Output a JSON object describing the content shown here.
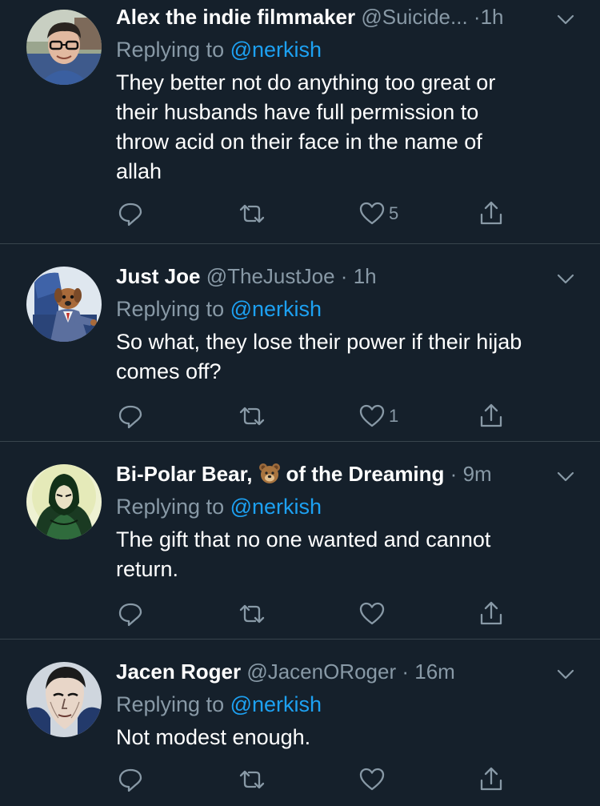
{
  "tweets": [
    {
      "display_name": "Alex the indie filmmaker",
      "handle": "@Suicide...",
      "separator": "·",
      "time": "1h",
      "replying_prefix": "Replying to",
      "replying_mention": "@nerkish",
      "text": "They better not do anything too great or\ntheir husbands have full permission to\nthrow acid on their face in the name of\nallah",
      "like_count": "5",
      "avatar": "man-with-glasses-avatar"
    },
    {
      "display_name": "Just Joe",
      "handle": "@TheJustJoe",
      "separator": "·",
      "time": "1h",
      "replying_prefix": "Replying to",
      "replying_mention": "@nerkish",
      "text": "So what, they lose their power if their hijab\ncomes off?",
      "like_count": "1",
      "avatar": "cartoon-dog-in-chair-avatar"
    },
    {
      "display_name_part1": "Bi-Polar Bear,",
      "display_name_emoji": "bear-face-emoji",
      "display_name_part2": "of the Dreaming",
      "separator": "·",
      "time": "9m",
      "replying_prefix": "Replying to",
      "replying_mention": "@nerkish",
      "text": "The gift that no one wanted and cannot\nreturn.",
      "like_count": "",
      "avatar": "hooded-hero-avatar"
    },
    {
      "display_name": "Jacen Roger",
      "handle": "@JacenORoger",
      "separator": "·",
      "time": "16m",
      "replying_prefix": "Replying to",
      "replying_mention": "@nerkish",
      "text": "Not modest enough.",
      "like_count": "",
      "avatar": "comic-hero-face-avatar"
    }
  ],
  "icons": {
    "reply": "reply-icon",
    "retweet": "retweet-icon",
    "like": "heart-icon",
    "share": "share-icon",
    "menu": "chevron-down-icon"
  },
  "colors": {
    "background": "#15202b",
    "divider": "#38444d",
    "secondary_text": "#8899a6",
    "accent": "#1da1f2",
    "primary_text": "#ffffff"
  }
}
